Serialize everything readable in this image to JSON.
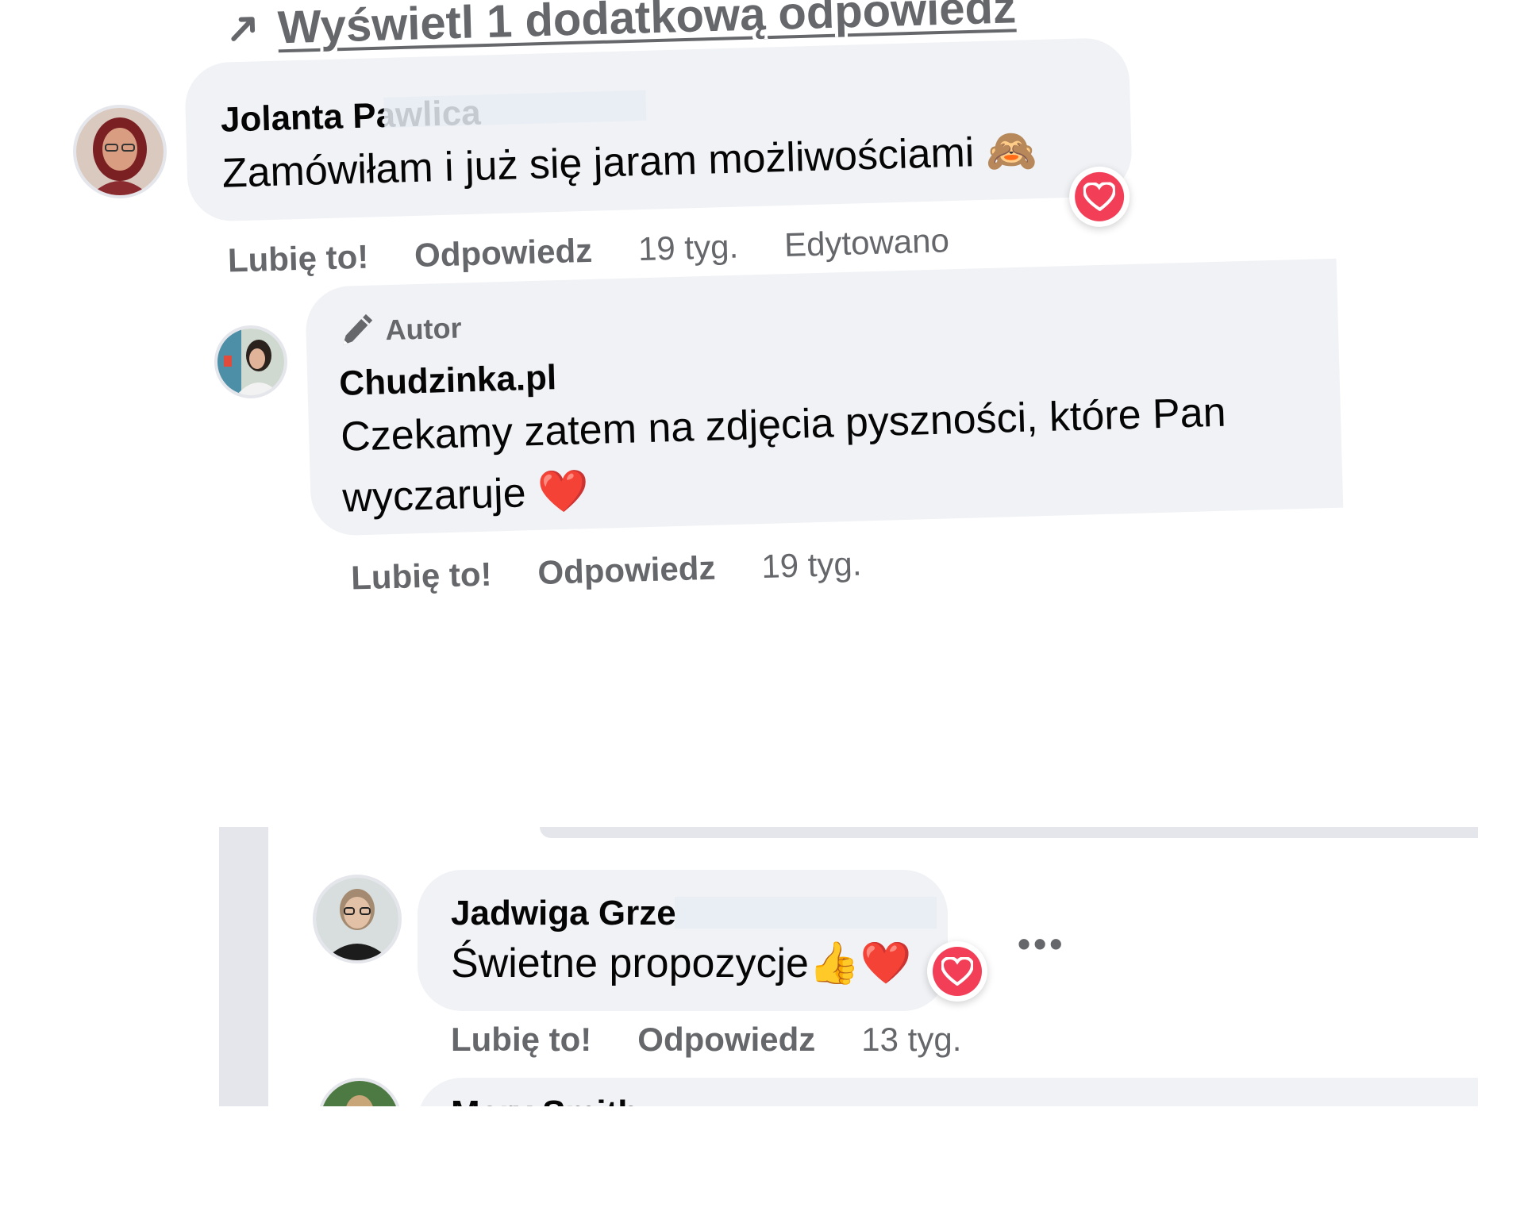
{
  "more_replies": {
    "label": "Wyświetl 1 dodatkową odpowiedź"
  },
  "comments": [
    {
      "author": "Jolanta Pawlica",
      "text": "Zamówiłam i już się jaram możliwościami 🙈",
      "reaction": "heart",
      "actions": {
        "like": "Lubię to!",
        "reply": "Odpowiedz",
        "time": "19 tyg.",
        "edited": "Edytowano"
      }
    },
    {
      "author_tag": "Autor",
      "author": "Chudzinka.pl",
      "text_line1": "Czekamy zatem na zdjęcia pyszności, które Pan",
      "text_line2": "wyczaruje ❤️",
      "actions": {
        "like": "Lubię to!",
        "reply": "Odpowiedz",
        "time": "19 tyg."
      }
    },
    {
      "author": "Jadwiga Grze",
      "text": "Świetne propozycje👍❤️",
      "reaction": "heart",
      "more": "•••",
      "actions": {
        "like": "Lubię to!",
        "reply": "Odpowiedz",
        "time": "13 tyg."
      }
    },
    {
      "author": "Mary Smith"
    }
  ],
  "colors": {
    "bubble": "#f0f2f5",
    "secondary_text": "#65676b",
    "heart": "#f33e58"
  },
  "icons": [
    "reply-arrow-icon",
    "heart-icon",
    "pen-icon",
    "more-icon"
  ]
}
